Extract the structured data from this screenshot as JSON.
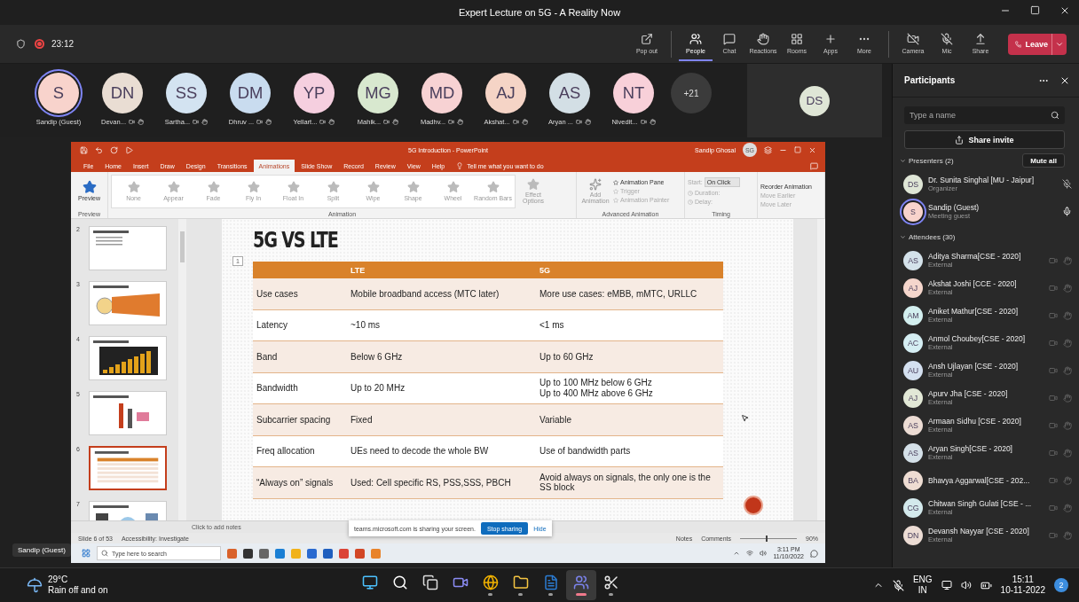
{
  "window": {
    "title": "Expert Lecture on 5G - A Reality Now"
  },
  "meeting": {
    "elapsed": "23:12",
    "recording": true,
    "tools": [
      {
        "label": "Pop out",
        "selected": false
      },
      {
        "label": "People",
        "selected": true
      },
      {
        "label": "Chat",
        "selected": false
      },
      {
        "label": "Reactions",
        "selected": false
      },
      {
        "label": "Rooms",
        "selected": false
      },
      {
        "label": "Apps",
        "selected": false
      },
      {
        "label": "More",
        "selected": false
      }
    ],
    "devices": [
      "Camera",
      "Mic",
      "Share"
    ],
    "leave": "Leave"
  },
  "video_strip": {
    "people": [
      {
        "initials": "S",
        "name": "Sandip (Guest)",
        "color": "#f8d3cc",
        "self": true,
        "kind": "self"
      },
      {
        "initials": "DN",
        "name": "Devan...",
        "color": "#e9ddd3",
        "self": false,
        "kind": "remote"
      },
      {
        "initials": "SS",
        "name": "Sartha...",
        "color": "#d3e3f1",
        "self": false,
        "kind": "remote"
      },
      {
        "initials": "DM",
        "name": "Dhruv ...",
        "color": "#c9dcef",
        "self": false,
        "kind": "remote"
      },
      {
        "initials": "YP",
        "name": "Yellart...",
        "color": "#f5cfdf",
        "self": false,
        "kind": "remote"
      },
      {
        "initials": "MG",
        "name": "Mahik...",
        "color": "#d8e8cf",
        "self": false,
        "kind": "remote"
      },
      {
        "initials": "MD",
        "name": "Madhv...",
        "color": "#f7d2d3",
        "self": false,
        "kind": "remote"
      },
      {
        "initials": "AJ",
        "name": "Akshat...",
        "color": "#f5d4c6",
        "self": false,
        "kind": "remote"
      },
      {
        "initials": "AS",
        "name": "Aryan ...",
        "color": "#d3dfe5",
        "self": false,
        "kind": "remote"
      },
      {
        "initials": "NT",
        "name": "Nivedit...",
        "color": "#f8d0d9",
        "self": false,
        "kind": "remote"
      }
    ],
    "overflow": "+21",
    "pinned": {
      "initials": "DS",
      "color": "#dfe6d6"
    }
  },
  "shared_screen": {
    "presenter_label": "Sandip (Guest)",
    "powerpoint": {
      "doc_title": "5G Introduction  -  PowerPoint",
      "user": "Sandip Ghosal",
      "user_initials": "SG",
      "tabs": [
        {
          "label": "File",
          "selected": false
        },
        {
          "label": "Home",
          "selected": false
        },
        {
          "label": "Insert",
          "selected": false
        },
        {
          "label": "Draw",
          "selected": false
        },
        {
          "label": "Design",
          "selected": false
        },
        {
          "label": "Transitions",
          "selected": false
        },
        {
          "label": "Animations",
          "selected": true
        },
        {
          "label": "Slide Show",
          "selected": false
        },
        {
          "label": "Record",
          "selected": false
        },
        {
          "label": "Review",
          "selected": false
        },
        {
          "label": "View",
          "selected": false
        },
        {
          "label": "Help",
          "selected": false
        }
      ],
      "tell_me": "Tell me what you want to do",
      "ribbon": {
        "preview": "Preview",
        "effects": [
          "None",
          "Appear",
          "Fade",
          "Fly In",
          "Float In",
          "Split",
          "Wipe",
          "Shape",
          "Wheel",
          "Random Bars"
        ],
        "effect_options": "Effect Options",
        "add_animation": "Add Animation",
        "advanced": [
          "Animation Pane",
          "Trigger",
          "Animation Painter"
        ],
        "start_label": "Start:",
        "start_value": "On Click",
        "duration_label": "Duration:",
        "delay_label": "Delay:",
        "reorder": "Reorder Animation",
        "move": [
          "Move Earlier",
          "Move Later"
        ],
        "groups": [
          "Preview",
          "Animation",
          "Advanced Animation",
          "Timing"
        ]
      },
      "thumbnails": [
        {
          "number": "2",
          "selected": false
        },
        {
          "number": "3",
          "selected": false
        },
        {
          "number": "4",
          "selected": false
        },
        {
          "number": "5",
          "selected": false
        },
        {
          "number": "6",
          "selected": true
        },
        {
          "number": "7",
          "selected": false
        }
      ],
      "slide": {
        "title": "5G VS LTE",
        "marker": "1",
        "table": {
          "columns": [
            "",
            "LTE",
            "5G"
          ],
          "rows": [
            [
              "Use cases",
              "Mobile broadband access (MTC later)",
              "More use cases: eMBB, mMTC, URLLC"
            ],
            [
              "Latency",
              "~10 ms",
              "<1 ms"
            ],
            [
              "Band",
              "Below 6 GHz",
              "Up to 60 GHz"
            ],
            [
              "Bandwidth",
              "Up to 20 MHz",
              "Up to 100 MHz below 6 GHz\nUp to 400 MHz above 6 GHz"
            ],
            [
              "Subcarrier spacing",
              "Fixed",
              "Variable"
            ],
            [
              "Freq allocation",
              "UEs need to decode the whole BW",
              "Use of bandwidth parts"
            ],
            [
              "“Always on” signals",
              "Used: Cell specific RS, PSS,SSS, PBCH",
              "Avoid always on signals, the only one is the SS block"
            ]
          ]
        }
      },
      "notes_placeholder": "Click to add notes",
      "status": {
        "slide": "Slide 6 of 53",
        "accessibility": "Accessibility: Investigate",
        "notes": "Notes",
        "comments": "Comments",
        "zoom": "90%",
        "zoom_slider": {
          "level": 0.45
        }
      }
    },
    "share_notice": {
      "text": "teams.microsoft.com is sharing your screen.",
      "stop": "Stop sharing",
      "hide": "Hide"
    },
    "inner_taskbar": {
      "search_placeholder": "Type here to search",
      "time": "3:11 PM",
      "date": "11/10/2022"
    }
  },
  "participants": {
    "title": "Participants",
    "search_placeholder": "Type a name",
    "share_invite": "Share invite",
    "sections": [
      {
        "title": "Presenters (2)",
        "expanded": true,
        "action": "Mute all",
        "people": [
          {
            "initials": "DS",
            "name": "Dr. Sunita Singhal [MU - Jaipur]",
            "role": "Organizer",
            "color": "#dfe6d6",
            "self": false,
            "kind": "presenter",
            "muted": true
          },
          {
            "initials": "S",
            "name": "Sandip (Guest)",
            "role": "Meeting guest",
            "color": "#f8d3cc",
            "self": true,
            "kind": "presenter",
            "muted": false
          }
        ]
      },
      {
        "title": "Attendees (30)",
        "expanded": true,
        "people": [
          {
            "initials": "AS",
            "name": "Aditya Sharma[CSE - 2020]",
            "role": "External",
            "color": "#d4e2ea",
            "self": false,
            "kind": "attendee"
          },
          {
            "initials": "AJ",
            "name": "Akshat Joshi [CCE - 2020]",
            "role": "External",
            "color": "#f5d6cc",
            "self": false,
            "kind": "attendee"
          },
          {
            "initials": "AM",
            "name": "Aniket Mathur[CSE - 2020]",
            "role": "External",
            "color": "#d3efef",
            "self": false,
            "kind": "attendee"
          },
          {
            "initials": "AC",
            "name": "Anmol Choubey[CSE - 2020]",
            "role": "External",
            "color": "#d5eef3",
            "self": false,
            "kind": "attendee"
          },
          {
            "initials": "AU",
            "name": "Ansh Ujlayan [CSE - 2020]",
            "role": "External",
            "color": "#d4e0f0",
            "self": false,
            "kind": "attendee"
          },
          {
            "initials": "AJ",
            "name": "Apurv Jha [CSE - 2020]",
            "role": "External",
            "color": "#e2e8d6",
            "self": false,
            "kind": "attendee"
          },
          {
            "initials": "AS",
            "name": "Armaan Sidhu [CSE - 2020]",
            "role": "External",
            "color": "#ecdcd4",
            "self": false,
            "kind": "attendee"
          },
          {
            "initials": "AS",
            "name": "Aryan Singh[CSE - 2020]",
            "role": "External",
            "color": "#d4e0e8",
            "self": false,
            "kind": "attendee"
          },
          {
            "initials": "BA",
            "name": "Bhavya Aggarwal[CSE - 202...",
            "color": "#eedcd2",
            "self": false,
            "kind": "attendee"
          },
          {
            "initials": "CG",
            "name": "Chitwan Singh Gulati [CSE - ...",
            "role": "External",
            "color": "#d3e9ec",
            "self": false,
            "kind": "attendee"
          },
          {
            "initials": "DN",
            "name": "Devansh Nayyar [CSE - 2020]",
            "role": "External",
            "color": "#ecdcd4",
            "self": false,
            "kind": "attendee"
          }
        ]
      }
    ]
  },
  "taskbar": {
    "weather": {
      "temp": "29°C",
      "text": "Rain off and on"
    },
    "apps": [
      {
        "running": false,
        "active": false
      },
      {
        "running": false,
        "active": false
      },
      {
        "running": false,
        "active": false
      },
      {
        "running": false,
        "active": false
      },
      {
        "running": true,
        "active": false
      },
      {
        "running": true,
        "active": false
      },
      {
        "running": true,
        "active": false
      },
      {
        "running": true,
        "active": true
      },
      {
        "running": true,
        "active": false
      }
    ],
    "language": "ENG",
    "region": "IN",
    "time": "15:11",
    "date": "10-11-2022",
    "badge": "2"
  }
}
